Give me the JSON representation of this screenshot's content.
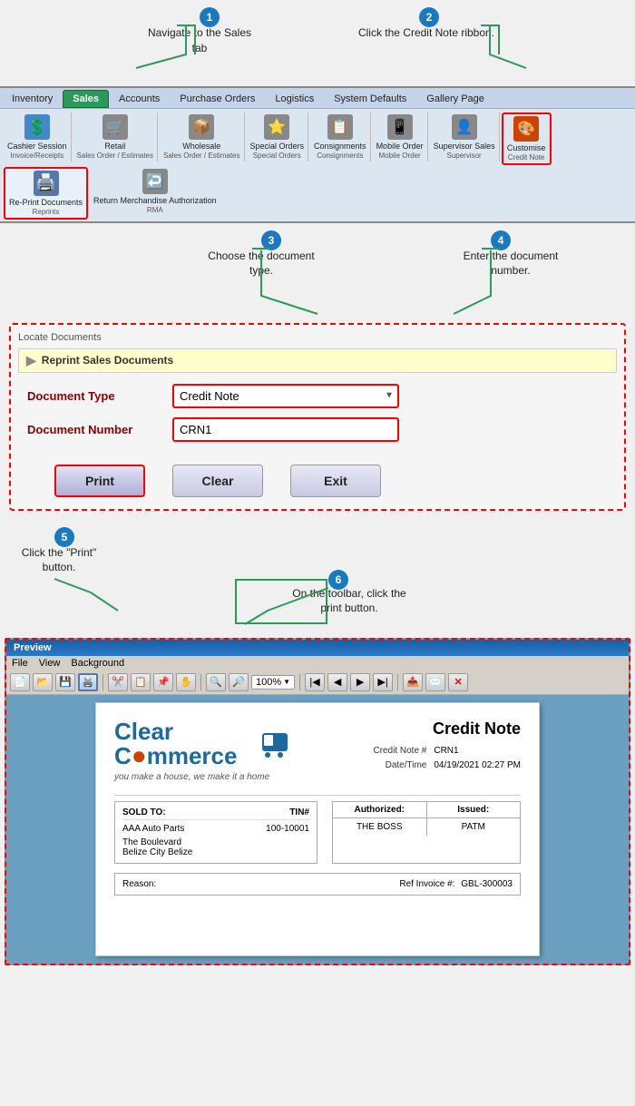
{
  "annotations": {
    "step1": {
      "number": "1",
      "text": "Navigate to\nthe Sales tab"
    },
    "step2": {
      "number": "2",
      "text": "Click the Credit Note\nribbon."
    },
    "step3": {
      "number": "3",
      "text": "Choose the\ndocument type."
    },
    "step4": {
      "number": "4",
      "text": "Enter the\ndocument number."
    },
    "step5": {
      "number": "5",
      "text": "Click the \"Print\"\nbutton."
    },
    "step6": {
      "number": "6",
      "text": "On the toolbar, click\nthe print button."
    }
  },
  "ribbon": {
    "tabs": [
      "Inventory",
      "Sales",
      "Accounts",
      "Purchase Orders",
      "Logistics",
      "System Defaults",
      "Gallery Page"
    ],
    "active_tab": "Sales",
    "icons": [
      {
        "label": "Cashier Session",
        "sublabel": "Invoice/Receipts",
        "icon": "$"
      },
      {
        "label": "Retail",
        "sublabel": "Sales Order / Estimates",
        "icon": "🛒"
      },
      {
        "label": "Wholesale",
        "sublabel": "Sales Order / Estimates",
        "icon": "📦"
      },
      {
        "label": "Special Orders",
        "sublabel": "Special Orders",
        "icon": "⭐"
      },
      {
        "label": "Consignments",
        "sublabel": "Consignments",
        "icon": "📋"
      },
      {
        "label": "Mobile Order",
        "sublabel": "Mobile Order",
        "icon": "📱"
      },
      {
        "label": "Supervisor Sales",
        "sublabel": "Supervisor",
        "icon": "👤"
      },
      {
        "label": "Customise",
        "sublabel": "Credit Note",
        "icon": "🎨"
      },
      {
        "label": "Re-Print Documents",
        "sublabel": "Reprints",
        "icon": "🖨️",
        "highlight": true
      },
      {
        "label": "Return Merchandise Authorization",
        "sublabel": "RMA",
        "icon": "↩️"
      }
    ]
  },
  "locate_documents": {
    "title": "Locate Documents",
    "section_header": "Reprint Sales Documents",
    "document_type_label": "Document Type",
    "document_type_value": "Credit Note",
    "document_number_label": "Document Number",
    "document_number_value": "CRN1",
    "buttons": {
      "print": "Print",
      "clear": "Clear",
      "exit": "Exit"
    }
  },
  "preview": {
    "title": "Preview",
    "menu": [
      "File",
      "View",
      "Background"
    ],
    "zoom": "100%",
    "document": {
      "title": "Credit Note",
      "logo_line1": "Clear",
      "logo_line2": "Commerce",
      "logo_tagline": "you make a house, we make it a home",
      "credit_note_label": "Credit Note #",
      "credit_note_value": "CRN1",
      "datetime_label": "Date/Time",
      "datetime_value": "04/19/2021 02:27 PM",
      "sold_to_label": "SOLD TO:",
      "tin_label": "TIN#",
      "customer_name": "AAA Auto Parts",
      "customer_tin": "100-10001",
      "customer_address": "The Boulevard",
      "customer_city": "Belize City Belize",
      "authorized_label": "Authorized:",
      "issued_label": "Issued:",
      "authorized_value": "THE BOSS",
      "issued_value": "PATM",
      "reason_label": "Reason:",
      "ref_invoice_label": "Ref Invoice #:",
      "ref_invoice_value": "GBL-300003"
    }
  }
}
